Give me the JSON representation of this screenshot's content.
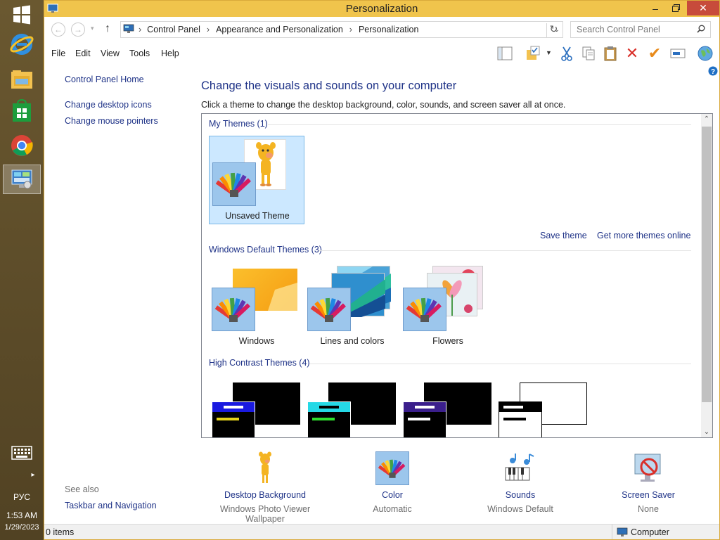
{
  "window": {
    "title": "Personalization"
  },
  "address": {
    "crumbs": [
      "Control Panel",
      "Appearance and Personalization",
      "Personalization"
    ],
    "search_placeholder": "Search Control Panel"
  },
  "menu": [
    "File",
    "Edit",
    "View",
    "Tools",
    "Help"
  ],
  "sidebar": {
    "links": [
      "Control Panel Home",
      "Change desktop icons",
      "Change mouse pointers"
    ],
    "see_also_label": "See also",
    "see_also_links": [
      "Taskbar and Navigation"
    ]
  },
  "main": {
    "title": "Change the visuals and sounds on your computer",
    "description": "Click a theme to change the desktop background, color, sounds, and screen saver all at once."
  },
  "themes": {
    "my_themes_header": "My Themes (1)",
    "my_themes": [
      {
        "label": "Unsaved Theme",
        "selected": true
      }
    ],
    "save_theme": "Save theme",
    "get_more": "Get more themes online",
    "default_header": "Windows Default Themes (3)",
    "default_themes": [
      {
        "label": "Windows"
      },
      {
        "label": "Lines and colors"
      },
      {
        "label": "Flowers"
      }
    ],
    "hc_header": "High Contrast Themes (4)"
  },
  "bottom": [
    {
      "label": "Desktop Background",
      "sub": "Windows Photo Viewer Wallpaper"
    },
    {
      "label": "Color",
      "sub": "Automatic"
    },
    {
      "label": "Sounds",
      "sub": "Windows Default"
    },
    {
      "label": "Screen Saver",
      "sub": "None"
    }
  ],
  "status": {
    "items": "0 items",
    "location": "Computer"
  },
  "taskbar": {
    "lang": "РУС",
    "time": "1:53 AM",
    "date": "1/29/2023"
  },
  "colors": {
    "title_bar": "#f0c44c",
    "link": "#1e3287",
    "taskbar": "#5b4a2a",
    "close": "#c74b3b"
  }
}
